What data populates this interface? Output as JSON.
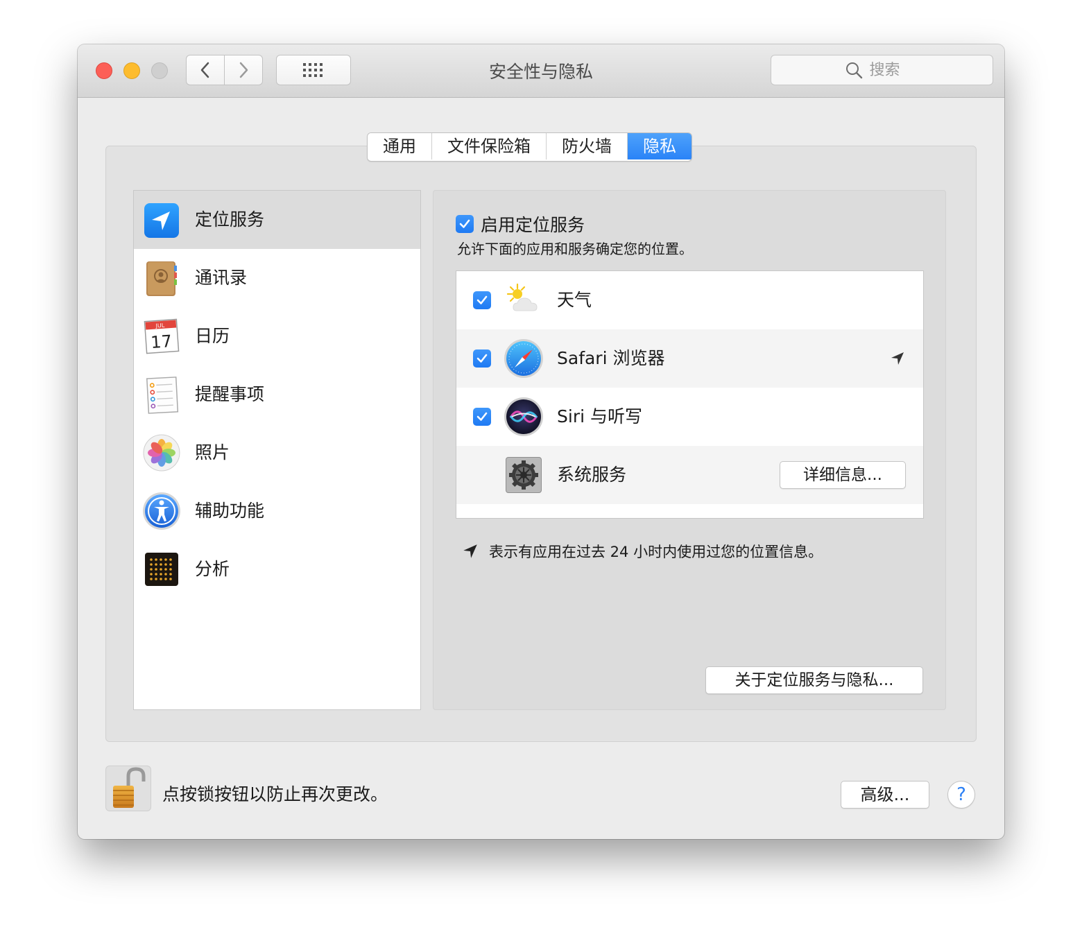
{
  "window": {
    "title": "安全性与隐私"
  },
  "toolbar": {
    "search_placeholder": "搜索"
  },
  "tabs": [
    {
      "label": "通用"
    },
    {
      "label": "文件保险箱"
    },
    {
      "label": "防火墙"
    },
    {
      "label": "隐私",
      "active": true
    }
  ],
  "sidebar": {
    "items": [
      {
        "label": "定位服务",
        "icon": "location-services-icon",
        "selected": true
      },
      {
        "label": "通讯录",
        "icon": "contacts-icon"
      },
      {
        "label": "日历",
        "icon": "calendar-icon",
        "icon_month": "JUL",
        "icon_day": "17"
      },
      {
        "label": "提醒事项",
        "icon": "reminders-icon"
      },
      {
        "label": "照片",
        "icon": "photos-icon"
      },
      {
        "label": "辅助功能",
        "icon": "accessibility-icon"
      },
      {
        "label": "分析",
        "icon": "analytics-icon"
      }
    ]
  },
  "detail": {
    "enable_label": "启用定位服务",
    "enable_checked": true,
    "description": "允许下面的应用和服务确定您的位置。",
    "apps": [
      {
        "label": "天气",
        "icon": "weather-icon",
        "checked": true
      },
      {
        "label": "Safari 浏览器",
        "icon": "safari-icon",
        "checked": true,
        "recent_use": true
      },
      {
        "label": "Siri 与听写",
        "icon": "siri-icon",
        "checked": true
      },
      {
        "label": "系统服务",
        "icon": "system-services-gear-icon",
        "details_label": "详细信息..."
      }
    ],
    "legend_text": "表示有应用在过去 24 小时内使用过您的位置信息。",
    "about_label": "关于定位服务与隐私..."
  },
  "footer": {
    "lock_text": "点按锁按钮以防止再次更改。",
    "advanced_label": "高级...",
    "help_label": "?"
  },
  "colors": {
    "accent": "#2a83f7",
    "close": "#fc5f57",
    "minimize": "#fdbc2e",
    "zoom_disabled": "#cfcfcf"
  }
}
